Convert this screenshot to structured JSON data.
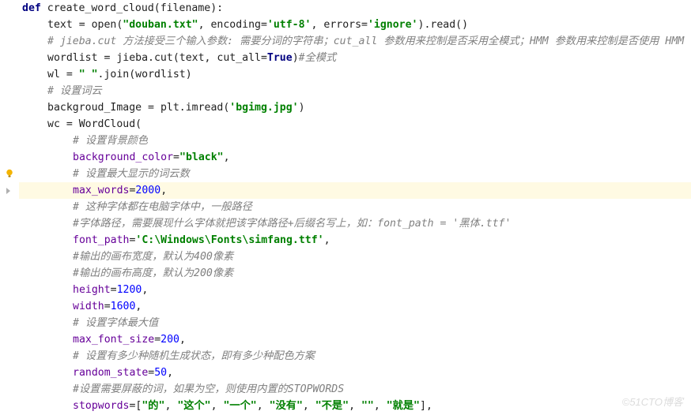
{
  "watermark": "©51CTO博客",
  "gutter": {
    "bulb_line_index": 10,
    "fold_line_index": 11
  },
  "tokens": {
    "l0": {
      "def": "def",
      "fn": "create_word_cloud",
      "p": "(filename)",
      "colon": ":"
    },
    "l1": {
      "a": "text ",
      "eq": "= ",
      "b": "open(",
      "s1": "\"douban.txt\"",
      "c": ", encoding=",
      "s2": "'utf-8'",
      "d": ", errors=",
      "s3": "'ignore'",
      "e": ").read()"
    },
    "l2": {
      "c": "# jieba.cut 方法接受三个输入参数: 需要分词的字符串；cut_all 参数用来控制是否采用全模式；HMM 参数用来控制是否使用 HMM"
    },
    "l3": {
      "a": "wordlist ",
      "eq": "= ",
      "b": "jieba.cut(text, cut_all=",
      "tru": "True",
      "c": ")",
      "cm": "#全模式"
    },
    "l4": {
      "a": "wl ",
      "eq": "= ",
      "s": "\" \"",
      "b": ".join(wordlist)"
    },
    "l5": {
      "c": "# 设置词云"
    },
    "l6": {
      "a": "backgroud_Image ",
      "eq": "= ",
      "b": "plt.imread(",
      "s": "'bgimg.jpg'",
      "c": ")"
    },
    "l7": {
      "a": "wc ",
      "eq": "= ",
      "b": "WordCloud("
    },
    "l8": {
      "c": "# 设置背景颜色"
    },
    "l9": {
      "k": "background_color",
      "eq": "=",
      "s": "\"black\"",
      "c": ","
    },
    "l10": {
      "c": "# 设置最大显示的词云数"
    },
    "l11": {
      "k": "max_words",
      "eq": "=",
      "n": "2000",
      "c": ","
    },
    "l12": {
      "c": "# 这种字体都在电脑字体中，一般路径"
    },
    "l13": {
      "c": "#字体路径，需要展现什么字体就把该字体路径+后缀名写上，如：font_path = '黑体.ttf'"
    },
    "l14": {
      "k": "font_path",
      "eq": "=",
      "s": "'C:\\Windows\\Fonts\\simfang.ttf'",
      "c": ","
    },
    "l15": {
      "c": "#输出的画布宽度，默认为400像素"
    },
    "l16": {
      "c": "#输出的画布高度，默认为200像素"
    },
    "l17": {
      "k": "height",
      "eq": "=",
      "n": "1200",
      "c": ","
    },
    "l18": {
      "k": "width",
      "eq": "=",
      "n": "1600",
      "c": ","
    },
    "l19": {
      "c": "# 设置字体最大值"
    },
    "l20": {
      "k": "max_font_size",
      "eq": "=",
      "n": "200",
      "c": ","
    },
    "l21": {
      "c": "# 设置有多少种随机生成状态，即有多少种配色方案"
    },
    "l22": {
      "k": "random_state",
      "eq": "=",
      "n": "50",
      "c": ","
    },
    "l23": {
      "c": "#设置需要屏蔽的词，如果为空，则使用内置的STOPWORDS"
    },
    "l24": {
      "k": "stopwords",
      "eq": "=[",
      "s1": "\"的\"",
      "s2": "\"这个\"",
      "s3": "\"一个\"",
      "s4": "\"没有\"",
      "s5": "\"不是\"",
      "s6": "\"\"",
      "s7": "\"就是\"",
      "sep": ", ",
      "close": "],"
    }
  }
}
